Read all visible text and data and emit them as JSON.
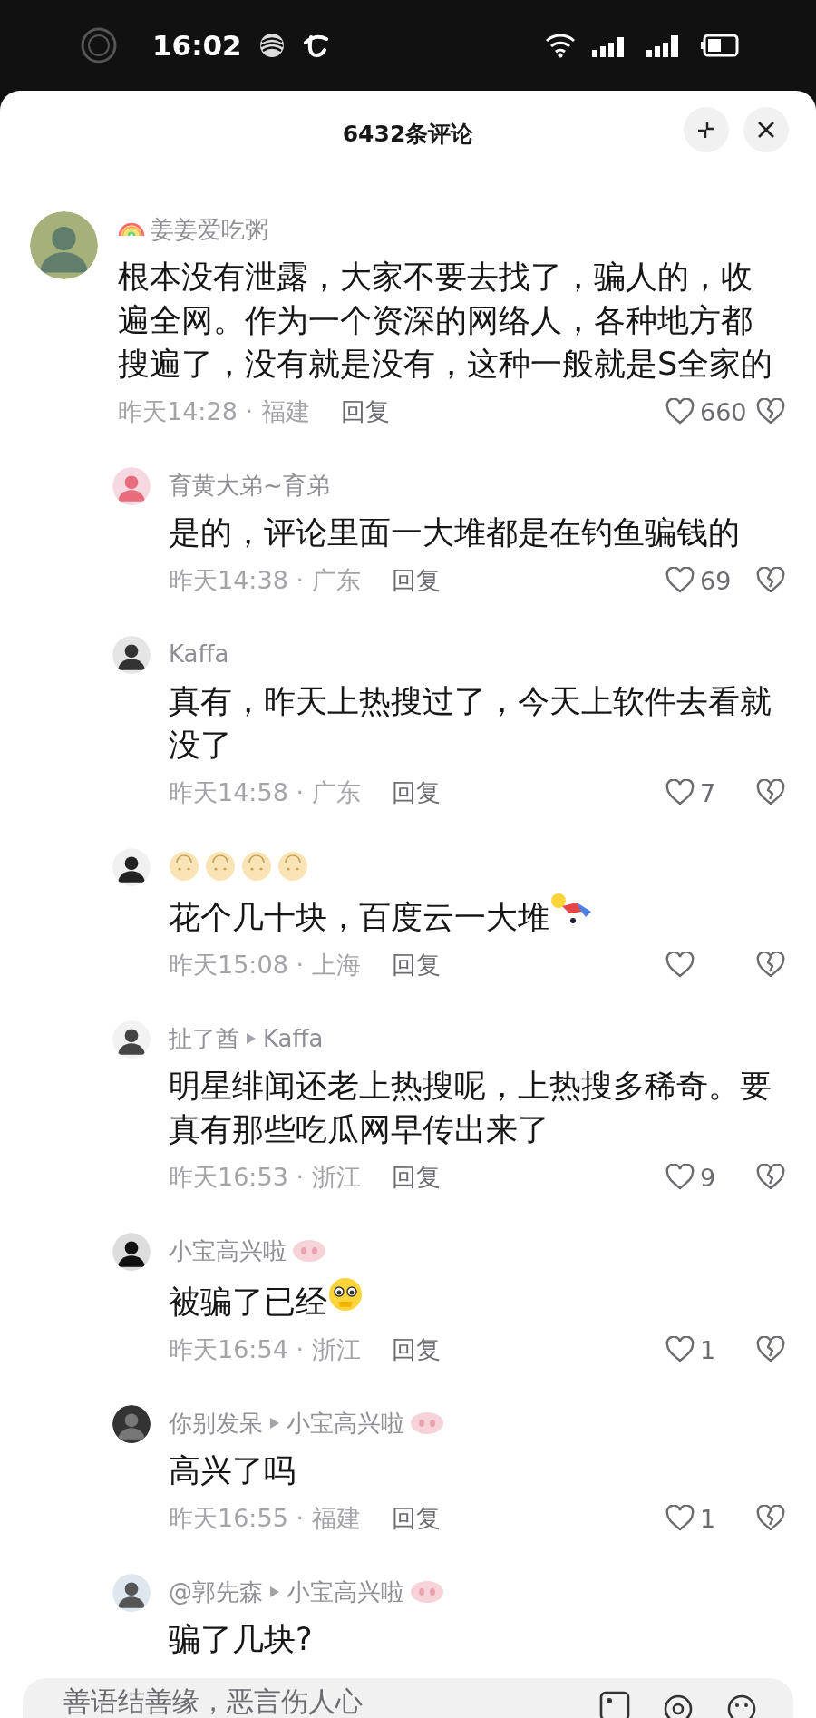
{
  "status_bar": {
    "time": "16:02"
  },
  "header": {
    "title": "6432条评论"
  },
  "comments": [
    {
      "name": "姜姜爱吃粥",
      "name_prefix_icon": {
        "kind": "rainbow"
      },
      "text": "根本没有泄露，大家不要去找了，骗人的，收遍全网。作为一个资深的网络人，各种地方都搜遍了，没有就是没有，这种一般就是S全家的",
      "time": "昨天14:28 · 福建",
      "reply": "回复",
      "likes": "660",
      "replies": [
        {
          "name": "育黄大弟~育弟",
          "text": "是的，评论里面一大堆都是在钓鱼骗钱的",
          "time": "昨天14:38 · 广东",
          "reply": "回复",
          "likes": "69"
        },
        {
          "name": "Kaffa",
          "text": "真有，昨天上热搜过了，今天上软件去看就没了",
          "time": "昨天14:58 · 广东",
          "reply": "回复",
          "likes": "7"
        },
        {
          "name_badges": [
            {
              "kind": "face"
            },
            {
              "kind": "face"
            },
            {
              "kind": "face"
            },
            {
              "kind": "face"
            }
          ],
          "text": "花个几十块，百度云一大堆",
          "text_emoji": {
            "kind": "figure"
          },
          "time": "昨天15:08 · 上海",
          "reply": "回复"
        },
        {
          "name": "扯了酋",
          "reply_to": "Kaffa",
          "text": "明星绯闻还老上热搜呢，上热搜多稀奇。要真有那些吃瓜网早传出来了",
          "time": "昨天16:53 · 浙江",
          "reply": "回复",
          "likes": "9"
        },
        {
          "name": "小宝高兴啦",
          "name_suffix_icon": {
            "kind": "pig"
          },
          "text": "被骗了已经",
          "text_emoji": {
            "kind": "crying"
          },
          "time": "昨天16:54 · 浙江",
          "reply": "回复",
          "likes": "1"
        },
        {
          "name": "你别发呆",
          "reply_to": "小宝高兴啦",
          "reply_to_suffix_icon": {
            "kind": "pig"
          },
          "text": "高兴了吗",
          "time": "昨天16:55 · 福建",
          "reply": "回复",
          "likes": "1"
        },
        {
          "name": "@郭先森",
          "reply_to": "小宝高兴啦",
          "reply_to_suffix_icon": {
            "kind": "pig"
          },
          "text": "骗了几块?"
        }
      ]
    }
  ],
  "input": {
    "placeholder": "善语结善缘，恶言伤人心"
  }
}
